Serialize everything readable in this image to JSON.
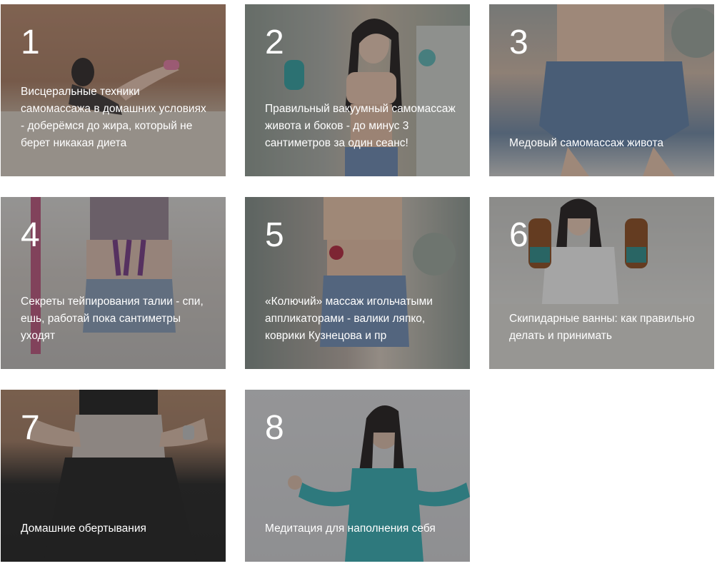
{
  "cards": [
    {
      "number": "1",
      "caption": "Висцеральные техники самомассажа в домашних условиях - доберёмся до жира, который не берет никакая диета"
    },
    {
      "number": "2",
      "caption": "Правильный вакуумный самомассаж живота и боков - до минус 3 сантиметров за один сеанс!"
    },
    {
      "number": "3",
      "caption": "Медовый самомассаж живота"
    },
    {
      "number": "4",
      "caption": "Секреты тейпирования талии - спи, ешь, работай пока сантиметры уходят"
    },
    {
      "number": "5",
      "caption": "«Колючий» массаж игольчатыми аппликаторами - валики ляпко, коврики Кузнецова и пр"
    },
    {
      "number": "6",
      "caption": "Скипидарные ванны: как правильно делать и принимать"
    },
    {
      "number": "7",
      "caption": "Домашние обертывания"
    },
    {
      "number": "8",
      "caption": "Медитация для наполнения себя"
    }
  ]
}
